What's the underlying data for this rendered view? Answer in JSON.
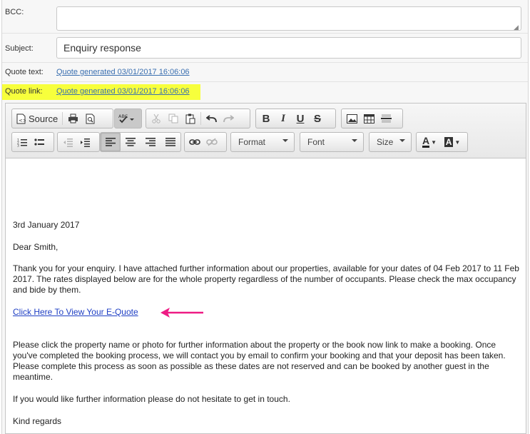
{
  "fields": {
    "bcc_label": "BCC:",
    "bcc_value": "",
    "subject_label": "Subject:",
    "subject_value": "Enquiry response",
    "quote_text_label": "Quote text:",
    "quote_text_link": "Quote generated 03/01/2017 16:06:06",
    "quote_link_label": "Quote link:",
    "quote_link_link": "Quote generated 03/01/2017 16:06:06",
    "highlight_color": "#f7ff3c"
  },
  "toolbar": {
    "source_label": "Source",
    "format_label": "Format",
    "font_label": "Font",
    "size_label": "Size",
    "buttons_row1": [
      "source",
      "print",
      "preview",
      "spellcheck",
      "cut",
      "copy",
      "paste",
      "undo",
      "redo",
      "bold",
      "italic",
      "underline",
      "strikethrough",
      "image",
      "table",
      "horizontal-rule"
    ],
    "buttons_row2": [
      "numbered-list",
      "bulleted-list",
      "decrease-indent",
      "increase-indent",
      "align-left",
      "align-center",
      "align-right",
      "justify",
      "link",
      "unlink",
      "format",
      "font",
      "size",
      "text-color",
      "background-color"
    ],
    "bold_glyph": "B",
    "italic_glyph": "I",
    "underline_glyph": "U",
    "strike_glyph": "S",
    "text_color_glyph": "A",
    "bg_color_glyph": "A"
  },
  "body": {
    "date": "3rd January 2017",
    "greeting": "Dear Smith,",
    "para1": "Thank you for your enquiry. I have attached further information about our properties, available for your dates of 04 Feb 2017 to 11 Feb 2017. The rates displayed below are for the whole property regardless of the number of occupants. Please check the max occupancy and bide by them.",
    "equote_link": "Click Here To View Your E-Quote",
    "para2": "Please click the property name or photo for further information about the property or the book now link to make a booking. Once you've completed the booking process, we will contact you by email to confirm your booking and that your deposit has been taken. Please complete this process as soon as possible as these dates are not reserved and can be booked by another guest in the meantime.",
    "para3": "If you would like further information please do not hesitate to get in touch.",
    "closing": "Kind regards",
    "arrow_color": "#ee1b84"
  }
}
